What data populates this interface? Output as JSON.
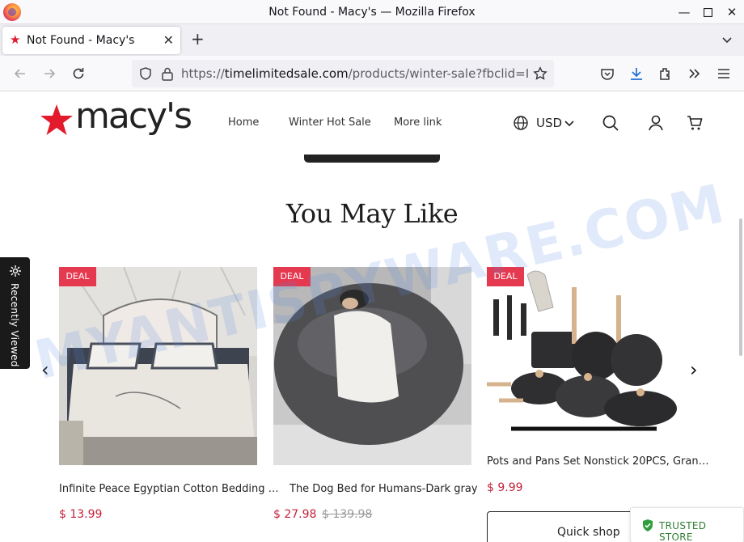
{
  "window": {
    "title": "Not Found - Macy's — Mozilla Firefox"
  },
  "tab": {
    "title": "Not Found - Macy's"
  },
  "address_bar": {
    "url_scheme": "https://",
    "url_domain": "timelimitedsale.com",
    "url_path": "/products/winter-sale?fbclid=IwA"
  },
  "header": {
    "logo_text": "macy's",
    "menu": [
      "Home",
      "Winter Hot Sale",
      "More link"
    ],
    "currency": "USD"
  },
  "section": {
    "title": "You May Like"
  },
  "recently_viewed": {
    "label": "Recently Viewed"
  },
  "products": [
    {
      "badge": "DEAL",
      "name": "Infinite Peace Egyptian Cotton Bedding …",
      "price": "$ 13.99",
      "old_price": ""
    },
    {
      "badge": "DEAL",
      "name": "The Dog Bed for Humans-Dark gray",
      "price": "$ 27.98",
      "old_price": "$ 139.98"
    },
    {
      "badge": "DEAL",
      "name": "Pots and Pans Set Nonstick 20PCS, Gran…",
      "price": "$ 9.99",
      "old_price": ""
    }
  ],
  "quick_shop": {
    "label": "Quick shop"
  },
  "trust_badge": {
    "label": "TRUSTED STORE"
  },
  "watermark": {
    "text": "MYANTISPYWARE.COM"
  },
  "colors": {
    "brand_red": "#e21a2c",
    "price_red": "#c4223b",
    "deal_badge": "#e53950"
  }
}
